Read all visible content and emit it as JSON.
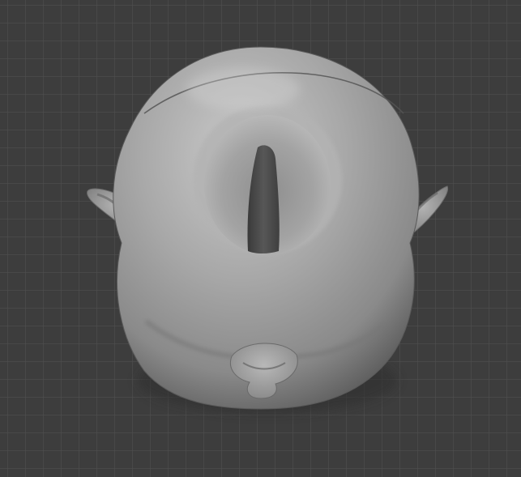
{
  "viewport": {
    "background_color": "#3d3d3d",
    "grid_color": "#505050",
    "mesh_color": "#9a9a9a",
    "mesh_shadow_color": "#2e2e2e"
  },
  "object": {
    "icon_name": "sculpted-cyclops-head-mesh"
  }
}
